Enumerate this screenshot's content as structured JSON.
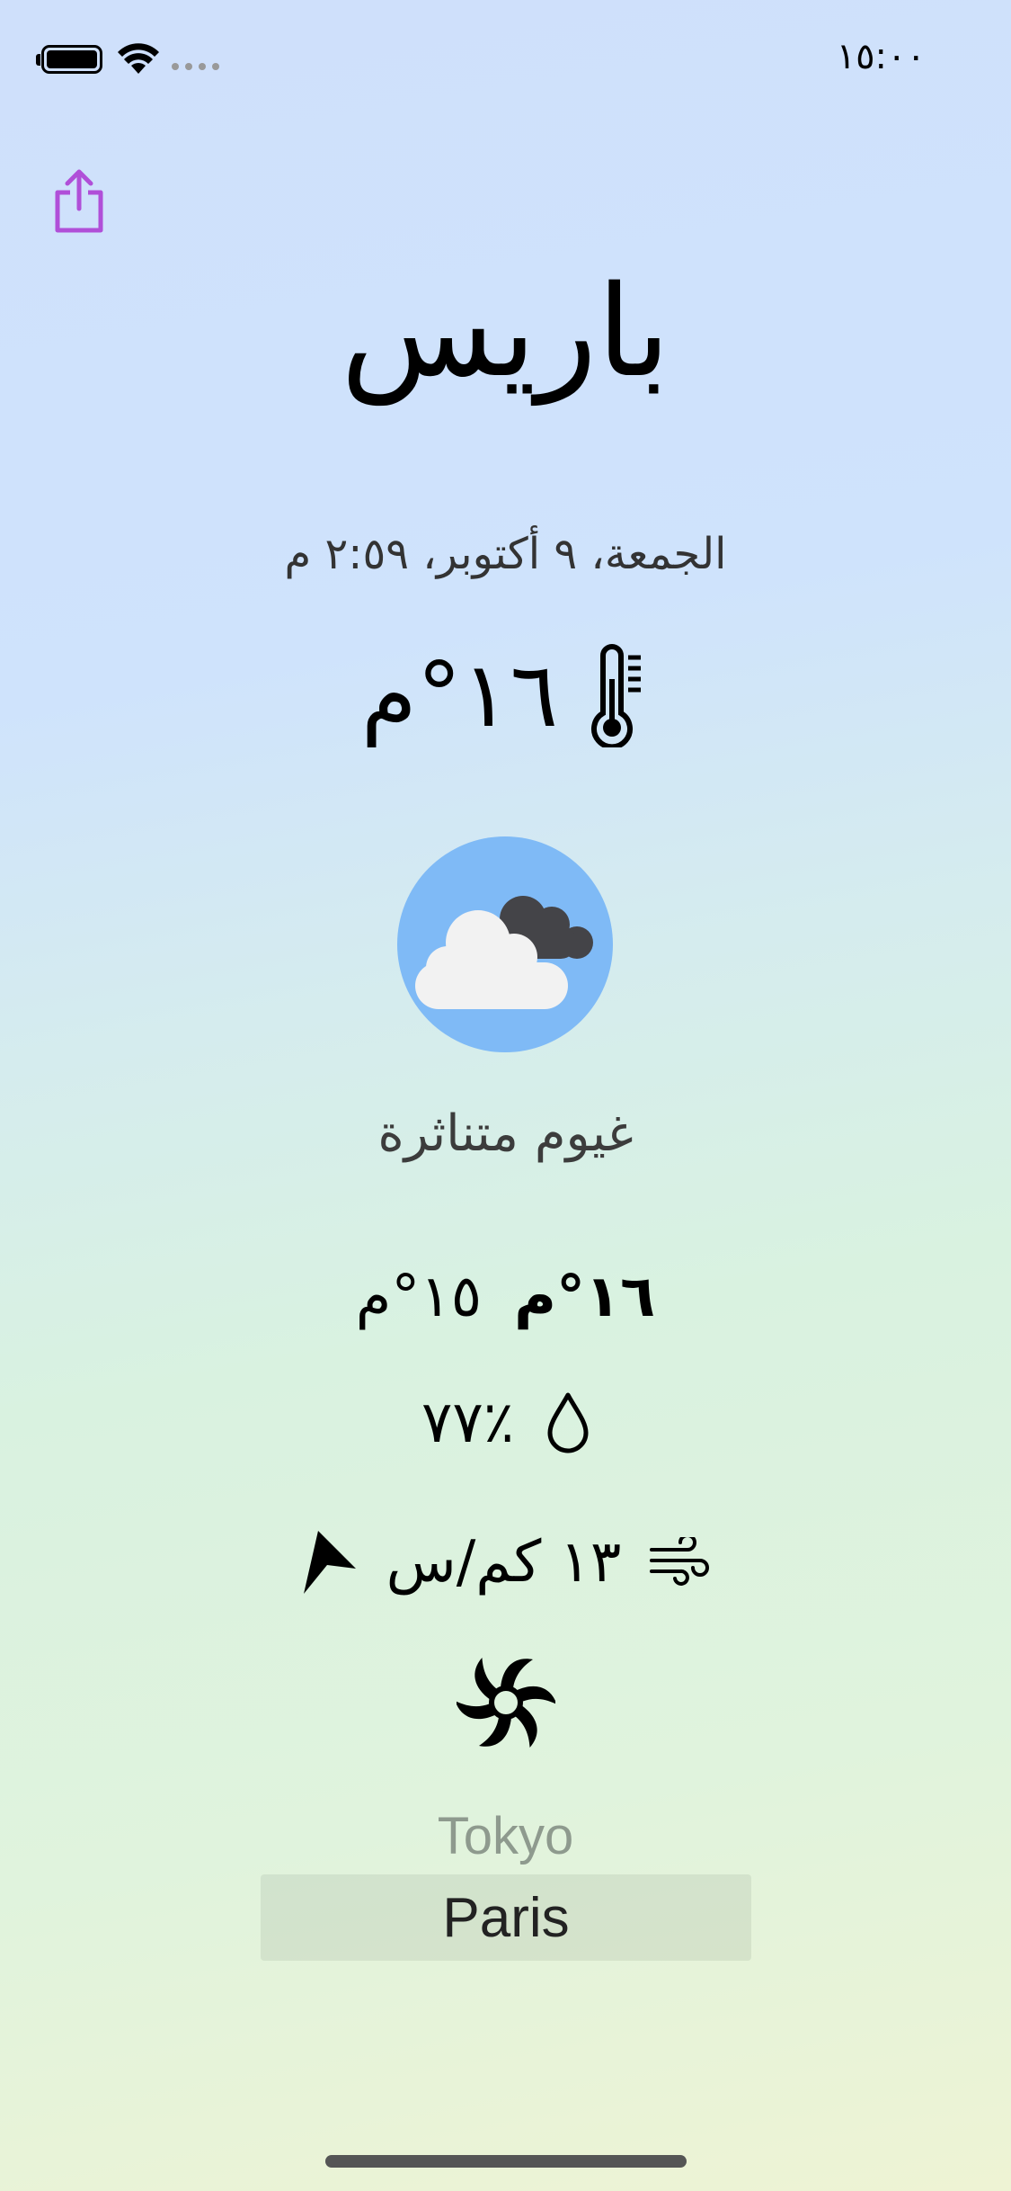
{
  "status_bar": {
    "time": "١٥:٠٠",
    "icons": [
      "battery-icon",
      "wifi-icon",
      "signal-dots-icon"
    ]
  },
  "toolbar": {
    "share_icon": "share-icon",
    "accent_color": "#b04fd8"
  },
  "weather": {
    "city": "باريس",
    "datetime": "الجمعة، ٩ أكتوبر، ٢:٥٩ م",
    "temperature": "١٦°م",
    "condition": "غيوم متناثرة",
    "temp_max": "١٦°م",
    "temp_min": "١٥°م",
    "humidity": "٪٧٧",
    "wind_speed": "١٣ كم/س",
    "icons": {
      "thermometer": "thermometer-icon",
      "condition": "scattered-clouds-icon",
      "humidity": "drop-icon",
      "wind": "wind-icon",
      "wind_direction": "wind-direction-arrow-icon",
      "loading": "spinner-icon"
    },
    "icon_background": "#7fbaf6"
  },
  "city_picker": {
    "options": [
      "Tokyo",
      "Paris"
    ],
    "selected": "Paris"
  }
}
